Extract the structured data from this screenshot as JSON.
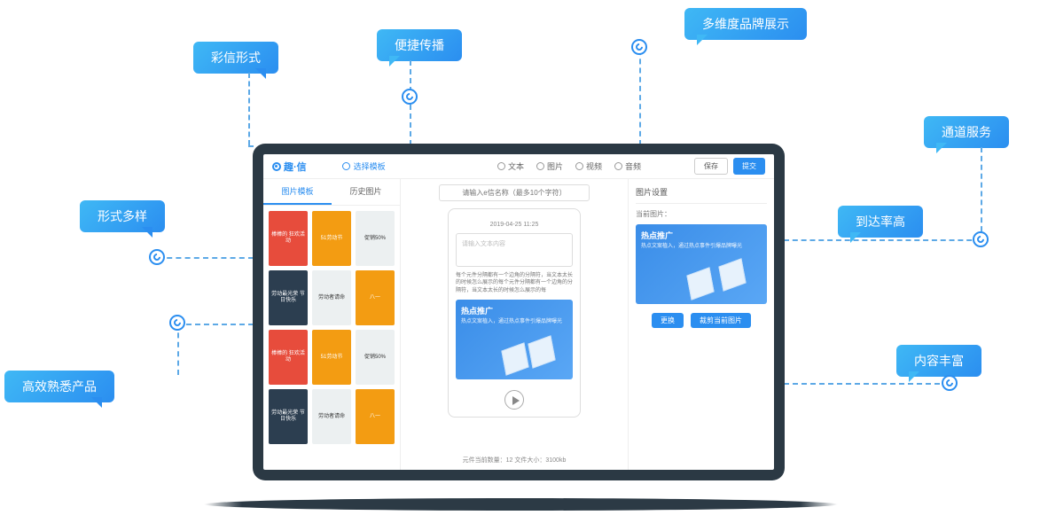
{
  "bubbles": {
    "mms": "彩信形式",
    "spread": "便捷传播",
    "brand": "多维度品牌展示",
    "channel": "通道服务",
    "forms": "形式多样",
    "reach": "到达率高",
    "efficient": "高效熟悉产品",
    "rich": "内容丰富"
  },
  "topbar": {
    "brand": "趣·信",
    "select_template": "选择模板",
    "segments": {
      "text": "文本",
      "image": "图片",
      "video": "视频",
      "audio": "音频"
    },
    "save": "保存",
    "submit": "提交"
  },
  "left": {
    "tab_tpl": "图片模板",
    "tab_history": "历史图片",
    "thumbs": [
      "棒棒的\n狂欢活动",
      "51劳动节",
      "促销50%",
      "劳动最光荣\n节日快乐",
      "劳动者请命",
      "八一",
      "棒棒的\n狂欢活动",
      "51劳动节",
      "促销50%",
      "劳动最光荣\n节日快乐",
      "劳动者请命",
      "八一"
    ]
  },
  "mid": {
    "name_placeholder": "请输入e信名称（最多10个字符）",
    "date": "2019-04-25  11:25",
    "text_placeholder": "请输入文本内容",
    "paragraph": "每个元件分隔都有一个边角的分隔符，当文本太长的时候怎么展示的每个元件分隔都有一个边角的分隔符，当文本太长的时候怎么展示的每",
    "hero_title": "热点推广",
    "hero_sub": "热点文案植入，通过热点事件引爆品牌曝光",
    "footer": "元件当前数量：12   文件大小：3100kb"
  },
  "right": {
    "heading": "图片设置",
    "current": "当前图片：",
    "hero_title": "热点推广",
    "hero_sub": "热点文案植入，通过热点事件引爆品牌曝光",
    "replace": "更换",
    "crop": "裁剪当前图片"
  }
}
